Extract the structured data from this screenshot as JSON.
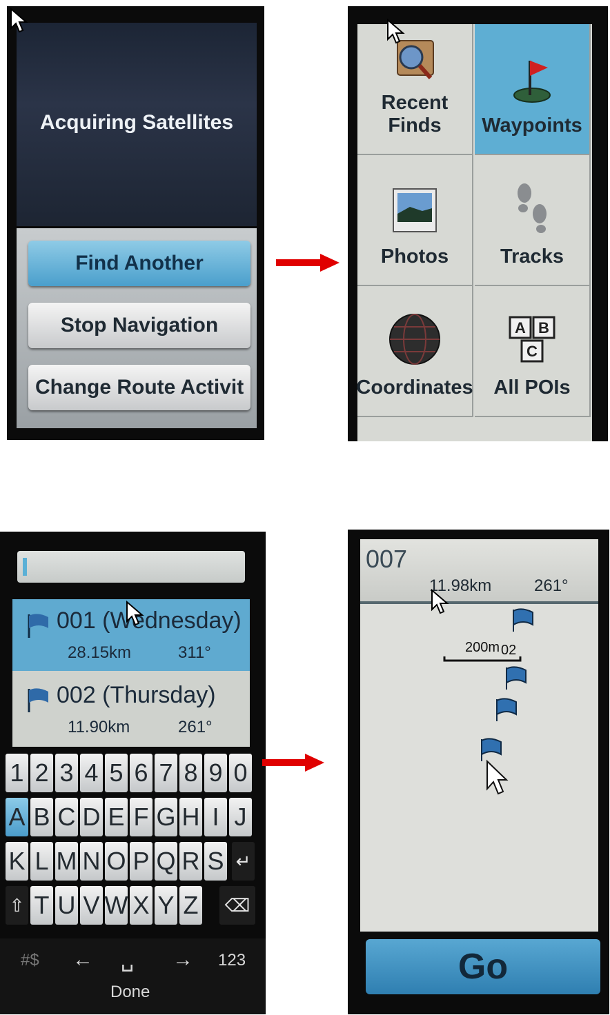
{
  "panel1": {
    "title": "Acquiring Satellites",
    "buttons": [
      {
        "label": "Find Another",
        "selected": true
      },
      {
        "label": "Stop Navigation",
        "selected": false
      },
      {
        "label": "Change Route Activit",
        "selected": false
      }
    ]
  },
  "panel2": {
    "tiles": [
      {
        "label": "Recent\nFinds",
        "icon": "recent-finds-icon",
        "selected": false
      },
      {
        "label": "Waypoints",
        "icon": "waypoint-flag-icon",
        "selected": true
      },
      {
        "label": "Photos",
        "icon": "photos-icon",
        "selected": false
      },
      {
        "label": "Tracks",
        "icon": "footprints-icon",
        "selected": false
      },
      {
        "label": "Coordinates",
        "icon": "globe-icon",
        "selected": false
      },
      {
        "label": "All POIs",
        "icon": "abc-blocks-icon",
        "selected": false
      }
    ]
  },
  "panel3": {
    "search_value": "",
    "waypoints": [
      {
        "name": "001 (Wednesday)",
        "distance": "28.15km",
        "bearing": "311°",
        "selected": true
      },
      {
        "name": "002 (Thursday)",
        "distance": "11.90km",
        "bearing": "261°",
        "selected": false
      }
    ],
    "keyboard": {
      "row1": [
        "1",
        "2",
        "3",
        "4",
        "5",
        "6",
        "7",
        "8",
        "9",
        "0"
      ],
      "row2": [
        "A",
        "B",
        "C",
        "D",
        "E",
        "F",
        "G",
        "H",
        "I",
        "J"
      ],
      "row3": [
        "K",
        "L",
        "M",
        "N",
        "O",
        "P",
        "Q",
        "R",
        "S"
      ],
      "row4": [
        "T",
        "U",
        "V",
        "W",
        "X",
        "Y",
        "Z"
      ],
      "enter_glyph": "↵",
      "shift_glyph": "⇧",
      "backspace_glyph": "⌫"
    },
    "bottom_bar": {
      "symbols": "#$",
      "left": "←",
      "space": "␣",
      "right": "→",
      "numbers": "123",
      "done": "Done"
    }
  },
  "panel4": {
    "title": "007",
    "distance": "11.98km",
    "bearing": "261°",
    "scale": "200m",
    "map_label": "02",
    "go_label": "Go"
  },
  "colors": {
    "selection_blue": "#5eaed3",
    "arrow_red": "#e00000"
  }
}
